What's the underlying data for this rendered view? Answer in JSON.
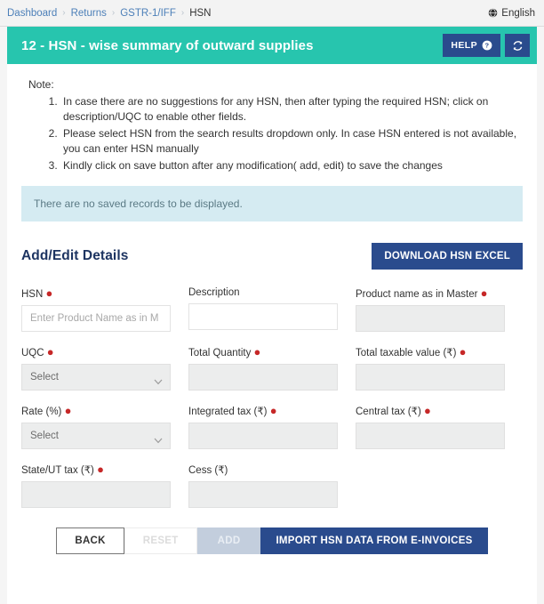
{
  "breadcrumb": {
    "items": [
      {
        "label": "Dashboard",
        "active": false
      },
      {
        "label": "Returns",
        "active": false
      },
      {
        "label": "GSTR-1/IFF",
        "active": false
      },
      {
        "label": "HSN",
        "active": true
      }
    ],
    "separator": "›"
  },
  "language": {
    "label": "English",
    "icon": "globe-icon"
  },
  "header": {
    "title": "12 - HSN - wise summary of outward supplies",
    "help_label": "HELP",
    "help_icon": "question-circle-icon",
    "refresh_icon": "refresh-icon",
    "background": "#27c5ae",
    "button_background": "#2a4b8d"
  },
  "note": {
    "title": "Note:",
    "items": [
      "In case there are no suggestions for any HSN, then after typing the required HSN; click on description/UQC to enable other fields.",
      "Please select HSN from the search results dropdown only. In case HSN entered is not available, you can enter HSN manually",
      "Kindly click on save button after any modification( add, edit) to save the changes"
    ]
  },
  "info_box": {
    "message": "There are no saved records to be displayed.",
    "background": "#d5ebf2"
  },
  "section": {
    "title": "Add/Edit Details",
    "download_label": "DOWNLOAD HSN EXCEL"
  },
  "form": {
    "rows": [
      {
        "fields": [
          {
            "label": "HSN",
            "required": true,
            "type": "text",
            "value": "",
            "placeholder": "Enter Product Name as in M",
            "disabled": false,
            "style": "white"
          },
          {
            "label": "Description",
            "required": false,
            "type": "text",
            "value": "",
            "placeholder": "",
            "disabled": false,
            "style": "white"
          },
          {
            "label": "Product name as in Master",
            "required": true,
            "type": "text",
            "value": "",
            "placeholder": "",
            "disabled": true,
            "style": "gray"
          }
        ]
      },
      {
        "fields": [
          {
            "label": "UQC",
            "required": true,
            "type": "select",
            "value": "Select",
            "placeholder": "",
            "disabled": false,
            "style": "gray"
          },
          {
            "label": "Total Quantity",
            "required": true,
            "type": "text",
            "value": "",
            "placeholder": "",
            "disabled": true,
            "style": "gray"
          },
          {
            "label": "Total taxable value (₹)",
            "required": true,
            "type": "text",
            "value": "",
            "placeholder": "",
            "disabled": true,
            "style": "gray"
          }
        ]
      },
      {
        "fields": [
          {
            "label": "Rate (%)",
            "required": true,
            "type": "select",
            "value": "Select",
            "placeholder": "",
            "disabled": false,
            "style": "gray"
          },
          {
            "label": "Integrated tax (₹)",
            "required": true,
            "type": "text",
            "value": "",
            "placeholder": "",
            "disabled": true,
            "style": "gray"
          },
          {
            "label": "Central tax (₹)",
            "required": true,
            "type": "text",
            "value": "",
            "placeholder": "",
            "disabled": true,
            "style": "gray"
          }
        ]
      },
      {
        "fields": [
          {
            "label": "State/UT tax (₹)",
            "required": true,
            "type": "text",
            "value": "",
            "placeholder": "",
            "disabled": true,
            "style": "gray"
          },
          {
            "label": "Cess (₹)",
            "required": false,
            "type": "text",
            "value": "",
            "placeholder": "",
            "disabled": true,
            "style": "gray"
          },
          null
        ]
      }
    ],
    "select_options": [
      "Select"
    ]
  },
  "footer": {
    "buttons": [
      {
        "label": "BACK",
        "kind": "back",
        "disabled": false
      },
      {
        "label": "RESET",
        "kind": "reset",
        "disabled": true
      },
      {
        "label": "ADD",
        "kind": "add",
        "disabled": true
      },
      {
        "label": "IMPORT HSN DATA FROM E-INVOICES",
        "kind": "import",
        "disabled": false
      }
    ]
  }
}
